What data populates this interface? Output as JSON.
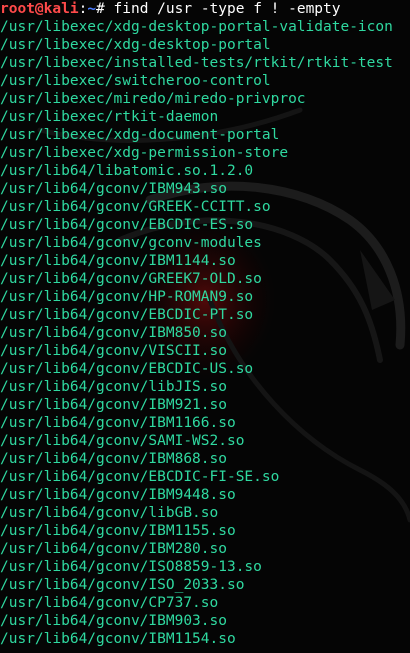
{
  "colors": {
    "background": "#050505",
    "prompt_user": "#ff4a4a",
    "prompt_path": "#4a7cff",
    "output_text": "#2fd9a0",
    "command_text": "#ffffff"
  },
  "prompt": {
    "user_host": "root@kali",
    "separator": ":",
    "path": "~",
    "symbol": "# ",
    "command": "find /usr -type f ! -empty"
  },
  "output": [
    "/usr/libexec/xdg-desktop-portal-validate-icon",
    "/usr/libexec/xdg-desktop-portal",
    "/usr/libexec/installed-tests/rtkit/rtkit-test",
    "/usr/libexec/switcheroo-control",
    "/usr/libexec/miredo/miredo-privproc",
    "/usr/libexec/rtkit-daemon",
    "/usr/libexec/xdg-document-portal",
    "/usr/libexec/xdg-permission-store",
    "/usr/lib64/libatomic.so.1.2.0",
    "/usr/lib64/gconv/IBM943.so",
    "/usr/lib64/gconv/GREEK-CCITT.so",
    "/usr/lib64/gconv/EBCDIC-ES.so",
    "/usr/lib64/gconv/gconv-modules",
    "/usr/lib64/gconv/IBM1144.so",
    "/usr/lib64/gconv/GREEK7-OLD.so",
    "/usr/lib64/gconv/HP-ROMAN9.so",
    "/usr/lib64/gconv/EBCDIC-PT.so",
    "/usr/lib64/gconv/IBM850.so",
    "/usr/lib64/gconv/VISCII.so",
    "/usr/lib64/gconv/EBCDIC-US.so",
    "/usr/lib64/gconv/libJIS.so",
    "/usr/lib64/gconv/IBM921.so",
    "/usr/lib64/gconv/IBM1166.so",
    "/usr/lib64/gconv/SAMI-WS2.so",
    "/usr/lib64/gconv/IBM868.so",
    "/usr/lib64/gconv/EBCDIC-FI-SE.so",
    "/usr/lib64/gconv/IBM9448.so",
    "/usr/lib64/gconv/libGB.so",
    "/usr/lib64/gconv/IBM1155.so",
    "/usr/lib64/gconv/IBM280.so",
    "/usr/lib64/gconv/ISO8859-13.so",
    "/usr/lib64/gconv/ISO_2033.so",
    "/usr/lib64/gconv/CP737.so",
    "/usr/lib64/gconv/IBM903.so",
    "/usr/lib64/gconv/IBM1154.so"
  ]
}
